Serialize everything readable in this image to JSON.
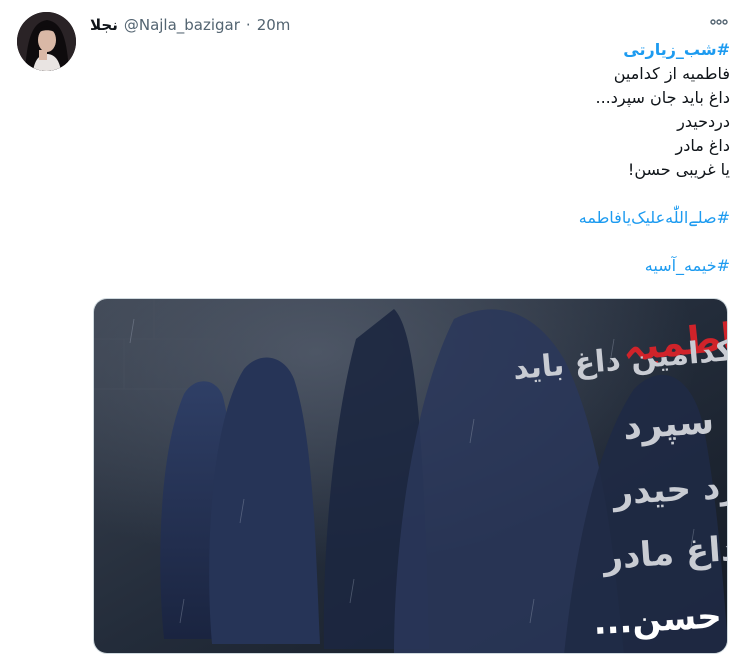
{
  "tweet": {
    "display_name": "نجلا",
    "handle": "@Najla_bazigar",
    "separator": "·",
    "time": "20m",
    "more_icon": "more-dots-icon",
    "hashtag_top": "#شب_زیارتی",
    "lines": [
      "فاطمیه از کدامین",
      "داغ باید جان سپرد...",
      "دردحیدر",
      "داغ مادر",
      "یا غریبی حسن!"
    ],
    "hashtag_2": "#صلے‌اللّٰه‌علیک‌یافاطمه",
    "hashtag_3": "#خیمه_آسیه"
  },
  "media": {
    "calligraphy_red": "فاطمیہ",
    "calligraphy_lines": [
      "از کدامین داغ باید",
      "جان سپرد",
      "درد حیدر",
      "داغ مادر",
      "یا غریبی حسن..."
    ],
    "colors": {
      "background_dark": "#1f2733",
      "veil_blue": "#2b3a5c",
      "red_text": "#d0232a",
      "pale_text": "#c9ccd3"
    }
  },
  "colors": {
    "link": "#1d9bf0",
    "text": "#0f1419",
    "muted": "#536471"
  }
}
